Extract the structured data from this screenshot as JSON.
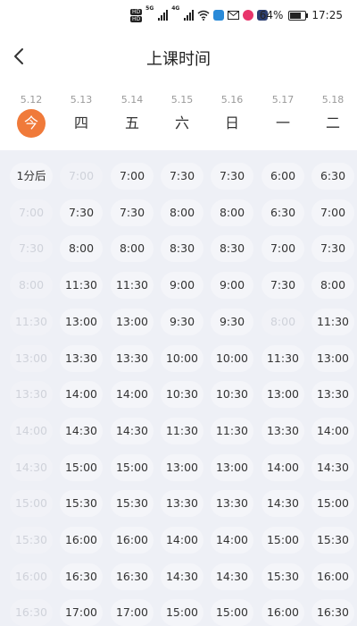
{
  "status_bar": {
    "hd1": "HD",
    "hd2": "HD",
    "sig1_tag": "5G",
    "sig2_tag": "4G",
    "battery": "64%",
    "time": "17:25"
  },
  "header": {
    "title": "上课时间"
  },
  "dates": [
    {
      "date": "5.12",
      "weekday": "今",
      "active": true
    },
    {
      "date": "5.13",
      "weekday": "四"
    },
    {
      "date": "5.14",
      "weekday": "五"
    },
    {
      "date": "5.15",
      "weekday": "六"
    },
    {
      "date": "5.16",
      "weekday": "日"
    },
    {
      "date": "5.17",
      "weekday": "一"
    },
    {
      "date": "5.18",
      "weekday": "二"
    }
  ],
  "columns": [
    [
      {
        "t": "1分后"
      },
      {
        "t": "7:00",
        "disabled": true
      },
      {
        "t": "7:30",
        "disabled": true
      },
      {
        "t": "8:00",
        "disabled": true
      },
      {
        "t": "11:30",
        "disabled": true
      },
      {
        "t": "13:00",
        "disabled": true
      },
      {
        "t": "13:30",
        "disabled": true
      },
      {
        "t": "14:00",
        "disabled": true
      },
      {
        "t": "14:30",
        "disabled": true
      },
      {
        "t": "15:00",
        "disabled": true
      },
      {
        "t": "15:30",
        "disabled": true
      },
      {
        "t": "16:00",
        "disabled": true
      },
      {
        "t": "16:30",
        "disabled": true
      }
    ],
    [
      {
        "t": "7:00",
        "disabled": true
      },
      {
        "t": "7:30"
      },
      {
        "t": "8:00"
      },
      {
        "t": "11:30"
      },
      {
        "t": "13:00"
      },
      {
        "t": "13:30"
      },
      {
        "t": "14:00"
      },
      {
        "t": "14:30"
      },
      {
        "t": "15:00"
      },
      {
        "t": "15:30"
      },
      {
        "t": "16:00"
      },
      {
        "t": "16:30"
      },
      {
        "t": "17:00"
      }
    ],
    [
      {
        "t": "7:00"
      },
      {
        "t": "7:30"
      },
      {
        "t": "8:00"
      },
      {
        "t": "11:30"
      },
      {
        "t": "13:00"
      },
      {
        "t": "13:30"
      },
      {
        "t": "14:00"
      },
      {
        "t": "14:30"
      },
      {
        "t": "15:00"
      },
      {
        "t": "15:30"
      },
      {
        "t": "16:00"
      },
      {
        "t": "16:30"
      },
      {
        "t": "17:00"
      }
    ],
    [
      {
        "t": "7:30"
      },
      {
        "t": "8:00"
      },
      {
        "t": "8:30"
      },
      {
        "t": "9:00"
      },
      {
        "t": "9:30"
      },
      {
        "t": "10:00"
      },
      {
        "t": "10:30"
      },
      {
        "t": "11:30"
      },
      {
        "t": "13:00"
      },
      {
        "t": "13:30"
      },
      {
        "t": "14:00"
      },
      {
        "t": "14:30"
      },
      {
        "t": "15:00"
      }
    ],
    [
      {
        "t": "7:30"
      },
      {
        "t": "8:00"
      },
      {
        "t": "8:30"
      },
      {
        "t": "9:00"
      },
      {
        "t": "9:30"
      },
      {
        "t": "10:00"
      },
      {
        "t": "10:30"
      },
      {
        "t": "11:30"
      },
      {
        "t": "13:00"
      },
      {
        "t": "13:30"
      },
      {
        "t": "14:00"
      },
      {
        "t": "14:30"
      },
      {
        "t": "15:00"
      }
    ],
    [
      {
        "t": "6:00"
      },
      {
        "t": "6:30"
      },
      {
        "t": "7:00"
      },
      {
        "t": "7:30"
      },
      {
        "t": "8:00",
        "disabled": true
      },
      {
        "t": "11:30"
      },
      {
        "t": "13:00"
      },
      {
        "t": "13:30"
      },
      {
        "t": "14:00"
      },
      {
        "t": "14:30"
      },
      {
        "t": "15:00"
      },
      {
        "t": "15:30"
      },
      {
        "t": "16:00"
      }
    ],
    [
      {
        "t": "6:30"
      },
      {
        "t": "7:00"
      },
      {
        "t": "7:30"
      },
      {
        "t": "8:00"
      },
      {
        "t": "11:30"
      },
      {
        "t": "13:00"
      },
      {
        "t": "13:30"
      },
      {
        "t": "14:00"
      },
      {
        "t": "14:30"
      },
      {
        "t": "15:00"
      },
      {
        "t": "15:30"
      },
      {
        "t": "16:00"
      },
      {
        "t": "16:30"
      }
    ]
  ],
  "colors": {
    "accent": "#f07a3a",
    "grid_bg": "#eef0f6"
  },
  "icons": {
    "back": "chevron-left-icon"
  }
}
